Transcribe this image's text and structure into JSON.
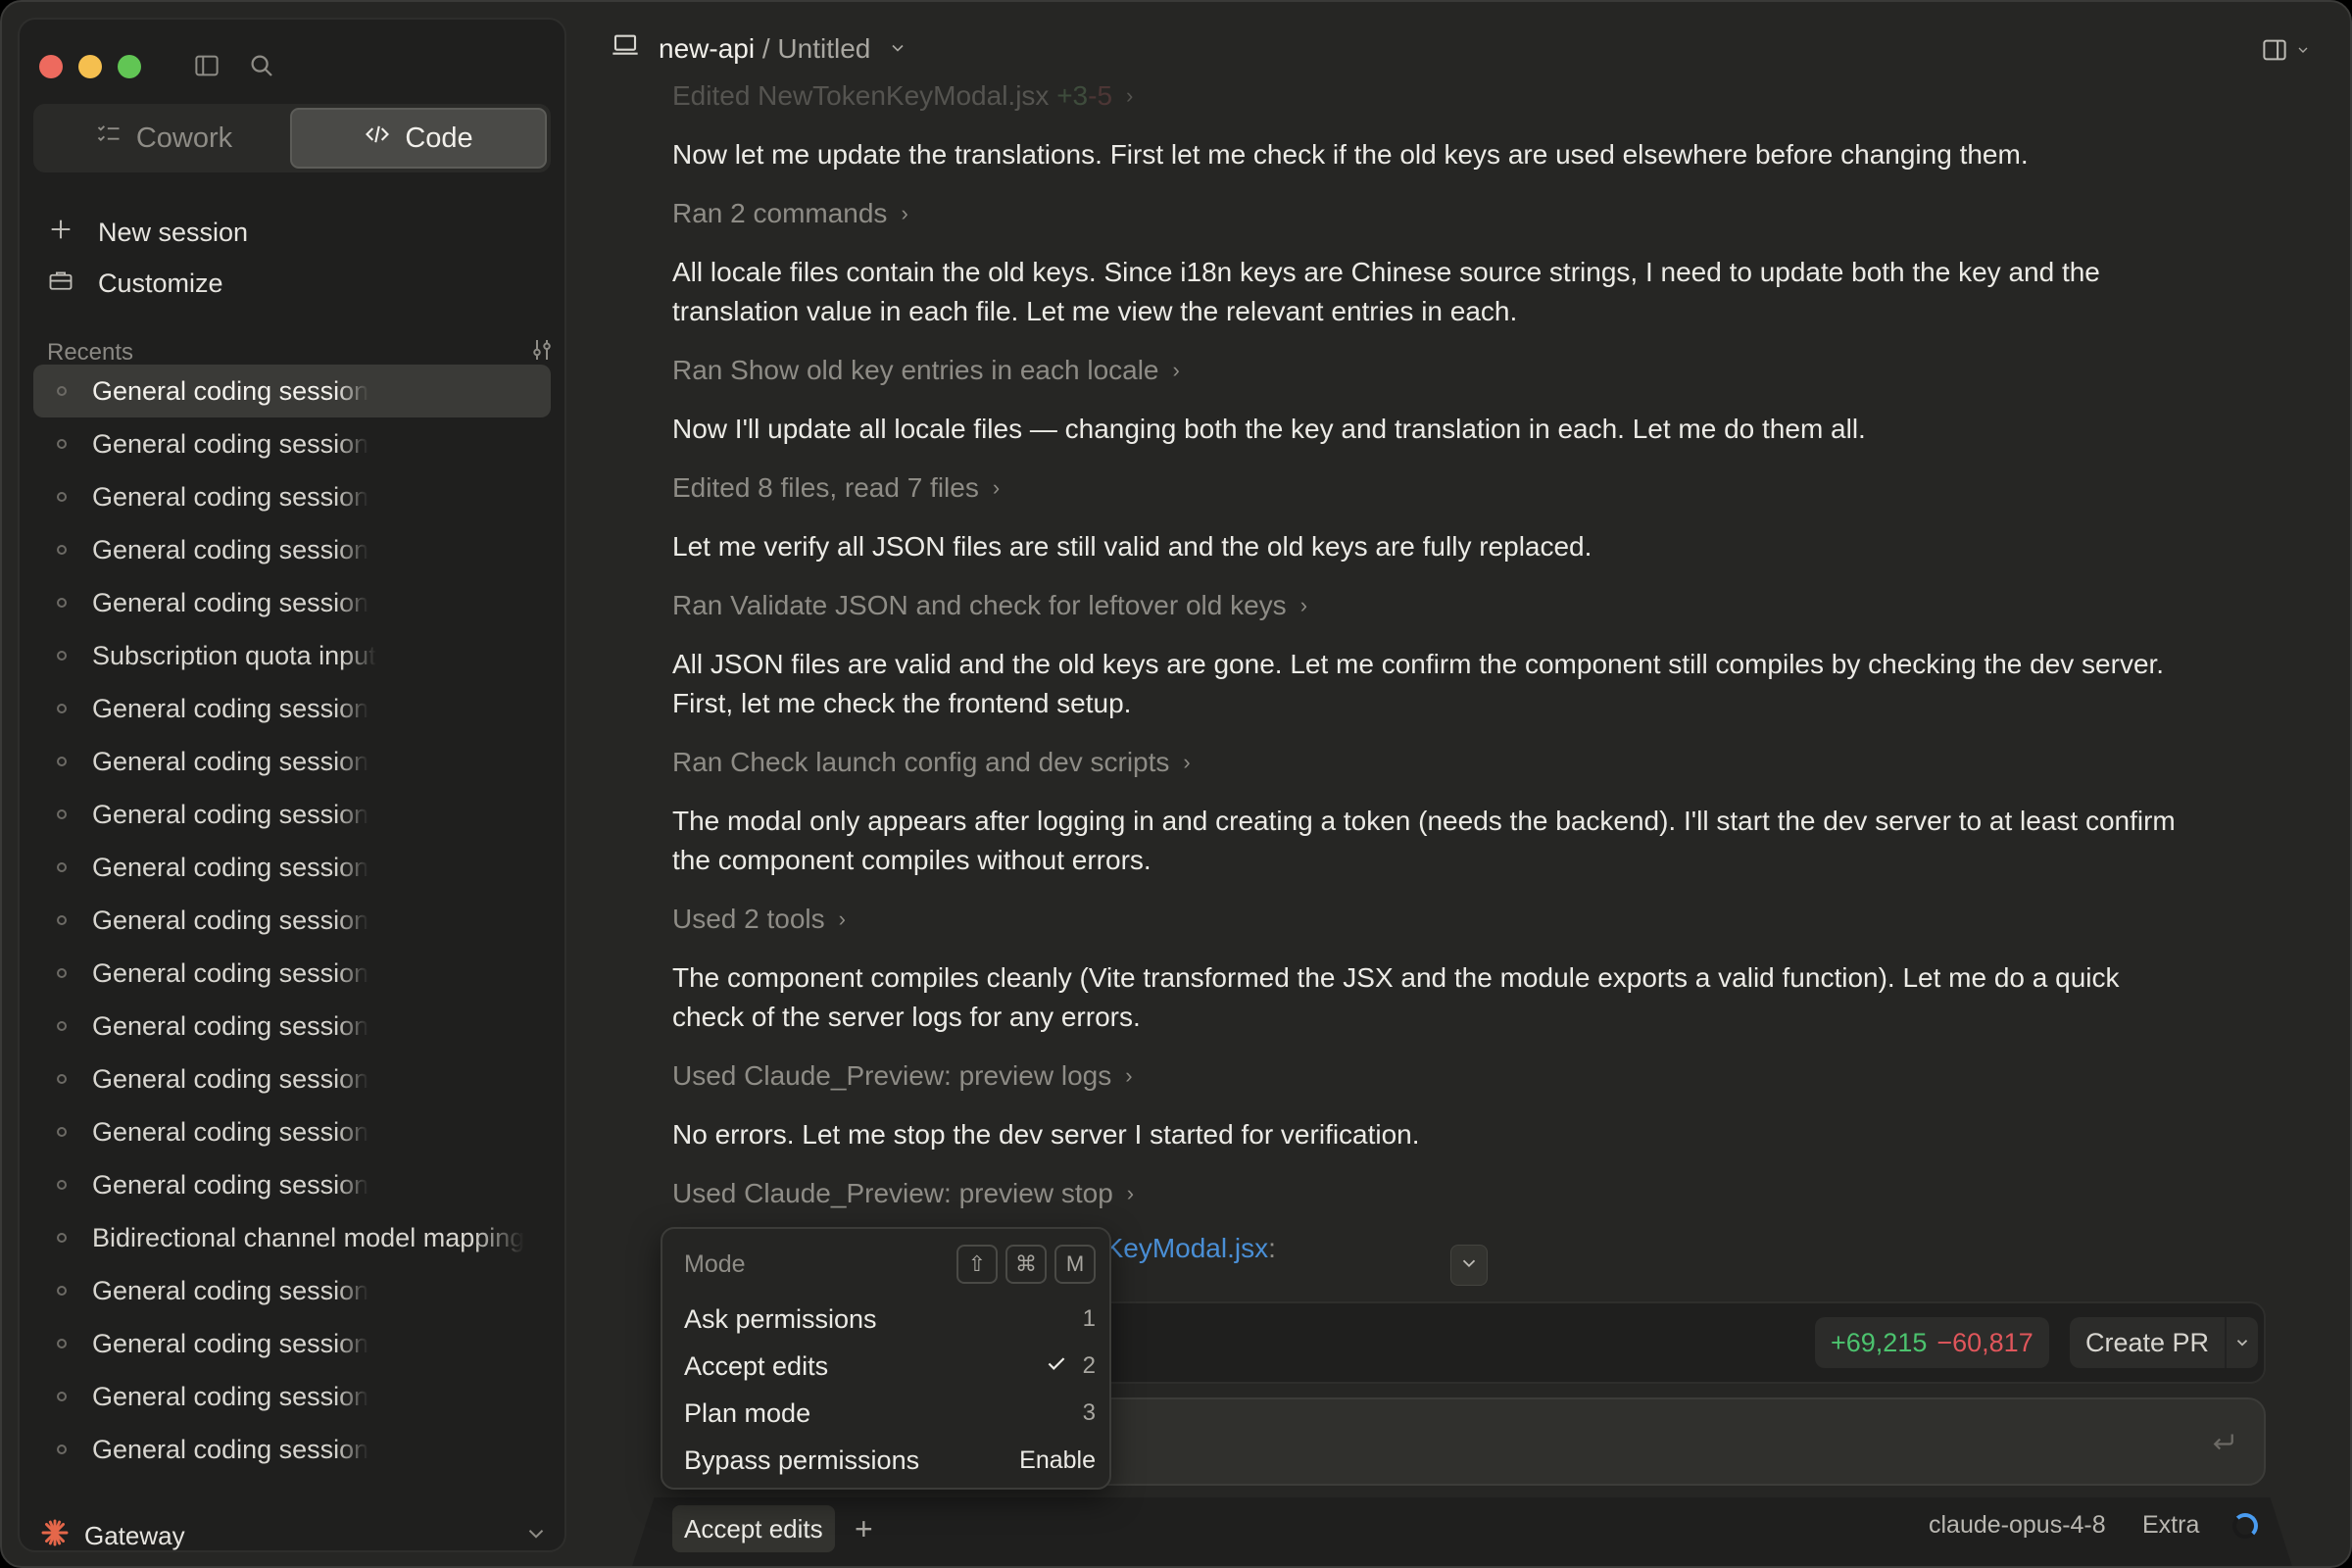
{
  "sidebar": {
    "mode_tabs": [
      {
        "label": "Cowork",
        "icon": "cowork-icon",
        "active": false
      },
      {
        "label": "Code",
        "icon": "code-icon",
        "active": true
      }
    ],
    "new_session_label": "New session",
    "customize_label": "Customize",
    "recents_label": "Recents",
    "recents": [
      "General coding session",
      "General coding session",
      "General coding session",
      "General coding session",
      "General coding session",
      "Subscription quota input",
      "General coding session",
      "General coding session",
      "General coding session",
      "General coding session",
      "General coding session",
      "General coding session",
      "General coding session",
      "General coding session",
      "General coding session",
      "General coding session",
      "Bidirectional channel model mapping",
      "General coding session",
      "General coding session",
      "General coding session",
      "General coding session"
    ],
    "active_recent_index": 0,
    "gateway_label": "Gateway"
  },
  "header": {
    "repo": "new-api",
    "separator": "/",
    "title": "Untitled"
  },
  "conversation": {
    "top_faded": {
      "label": "Edited NewTokenKeyModal.jsx",
      "added": "+3",
      "removed": "-5"
    },
    "m1": "Now let me update the translations. First let me check if the old keys are used elsewhere before changing them.",
    "t1": "Ran 2 commands",
    "m2a": "All locale files contain the old keys. Since i18n keys are Chinese source strings, I need to update both the key and the",
    "m2b": "translation value in each file. Let me view the relevant entries in each.",
    "t2": "Ran Show old key entries in each locale",
    "m3": "Now I'll update all locale files — changing both the key and translation in each. Let me do them all.",
    "t3": "Edited 8 files, read 7 files",
    "m4": "Let me verify all JSON files are still valid and the old keys are fully replaced.",
    "t4": "Ran Validate JSON and check for leftover old keys",
    "m5a": "All JSON files are valid and the old keys are gone. Let me confirm the component still compiles by checking the dev server.",
    "m5b": "First, let me check the frontend setup.",
    "t5": "Ran Check launch config and dev scripts",
    "m6a": "The modal only appears after logging in and creating a token (needs the backend). I'll start the dev server to at least confirm",
    "m6b": "the component compiles without errors.",
    "t6": "Used 2 tools",
    "m7a": "The component compiles cleanly (Vite transformed the JSX and the module exports a valid function). Let me do a quick",
    "m7b": "check of the server logs for any errors.",
    "t7": "Used Claude_Preview: preview logs",
    "m8": "No errors. Let me stop the dev server I started for verification.",
    "t8": "Used Claude_Preview: preview stop",
    "file_ref": "nKeyModal.jsx",
    "file_ref_suffix": ":"
  },
  "changes": {
    "added": "+69,215",
    "removed": "−60,817",
    "create_pr_label": "Create PR"
  },
  "footer": {
    "mode_button": "Accept edits",
    "plus": "+",
    "model": "claude-opus-4-8",
    "effort": "Extra"
  },
  "mode_menu": {
    "title": "Mode",
    "shortcut_keys": [
      "⇧",
      "⌘",
      "M"
    ],
    "items": [
      {
        "label": "Ask permissions",
        "shortcut": "1",
        "checked": false
      },
      {
        "label": "Accept edits",
        "shortcut": "2",
        "checked": true
      },
      {
        "label": "Plan mode",
        "shortcut": "3",
        "checked": false
      },
      {
        "label": "Bypass permissions",
        "shortcut": "Enable",
        "checked": false
      }
    ]
  },
  "colors": {
    "background": "#262624",
    "sidebar": "#1f1f1e",
    "diff_added": "#4cc36e",
    "diff_removed": "#e0565b",
    "link": "#4a8fd6",
    "gateway_logo": "#e5674a"
  }
}
